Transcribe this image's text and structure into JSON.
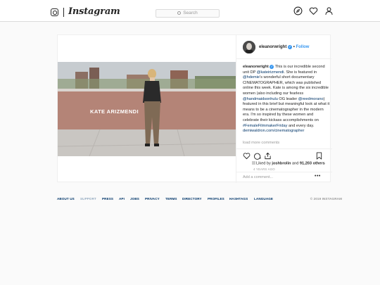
{
  "brand": {
    "wordmark": "Instagram"
  },
  "search": {
    "placeholder": "Search"
  },
  "nav": {
    "icons": [
      "compass-icon",
      "heart-icon",
      "person-icon"
    ]
  },
  "post": {
    "username": "eleanorwright",
    "follow_label": "Follow",
    "image_overlay": "KATE ARIZMENDI",
    "caption": {
      "username": "eleanorwright",
      "parts": [
        {
          "t": "This is our incredible second unit DP "
        },
        {
          "t": "@kateirizmendi",
          "link": true
        },
        {
          "t": ". She is featured in "
        },
        {
          "t": "@hdemie",
          "link": true
        },
        {
          "t": "'s wonderful short documentary CINEMATOGRAPHER, which was published online this week. Kate is among the six incredible women (also including our fearless "
        },
        {
          "t": "@handmaidsonhulu",
          "link": true
        },
        {
          "t": " OG leader "
        },
        {
          "t": "@reedmorano",
          "link": true
        },
        {
          "t": ") featured in this brief but meaningful look at what it means to be a cinematographer in the modern era. I'm so inspired by these women and celebrate their kickass accomplishments on "
        },
        {
          "t": "#FemaleFilmmakerFriday",
          "link": true
        },
        {
          "t": " and every day. "
        },
        {
          "t": "demiwaldron.com/cinematographer",
          "link": true
        }
      ]
    },
    "load_more": "load more comments",
    "likes": {
      "prefix": "Liked by",
      "user": "joshbrolin",
      "mid": "and",
      "count": "91,203 others"
    },
    "time": "4 YEARS AGO",
    "comment_placeholder": "Add a comment...",
    "more": "•••"
  },
  "footer": {
    "links": [
      "ABOUT US",
      "SUPPORT",
      "PRESS",
      "API",
      "JOBS",
      "PRIVACY",
      "TERMS",
      "DIRECTORY",
      "PROFILES",
      "HASHTAGS",
      "LANGUAGE"
    ],
    "copyright": "© 2019 INSTAGRAM"
  },
  "colors": {
    "link": "#003569",
    "accent": "#3897f0",
    "border": "#dbdbdb",
    "background": "#fafafa"
  }
}
